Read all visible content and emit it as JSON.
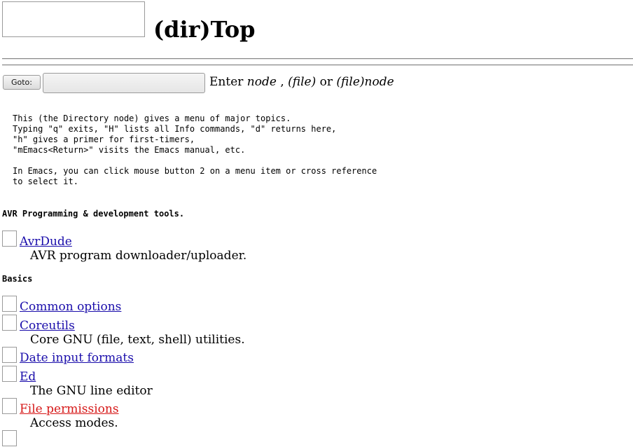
{
  "header": {
    "title": "(dir)Top"
  },
  "goto": {
    "button_label": "Goto:",
    "input_value": "",
    "hint_prefix": "Enter ",
    "hint_node": "node",
    "hint_sep1": " , ",
    "hint_file": "(file)",
    "hint_or": " or ",
    "hint_filenode": "(file)node"
  },
  "intro": "This (the Directory node) gives a menu of major topics.\nTyping \"q\" exits, \"H\" lists all Info commands, \"d\" returns here,\n\"h\" gives a primer for first-timers,\n\"mEmacs<Return>\" visits the Emacs manual, etc.\n\nIn Emacs, you can click mouse button 2 on a menu item or cross reference\nto select it.",
  "sections": [
    {
      "title": "AVR Programming & development tools.",
      "entries": [
        {
          "label": "AvrDude",
          "description": "AVR program downloader/uploader."
        }
      ]
    },
    {
      "title": "Basics",
      "entries": [
        {
          "label": "Common options",
          "description": ""
        },
        {
          "label": "Coreutils",
          "description": "Core GNU (file, text, shell) utilities."
        },
        {
          "label": "Date input formats",
          "description": ""
        },
        {
          "label": "Ed",
          "description": "The GNU line editor"
        },
        {
          "label": "File permissions",
          "description": "Access modes.",
          "visited": true
        }
      ]
    }
  ],
  "colors": {
    "link": "#1a0dab",
    "visited_link": "#d61818"
  }
}
